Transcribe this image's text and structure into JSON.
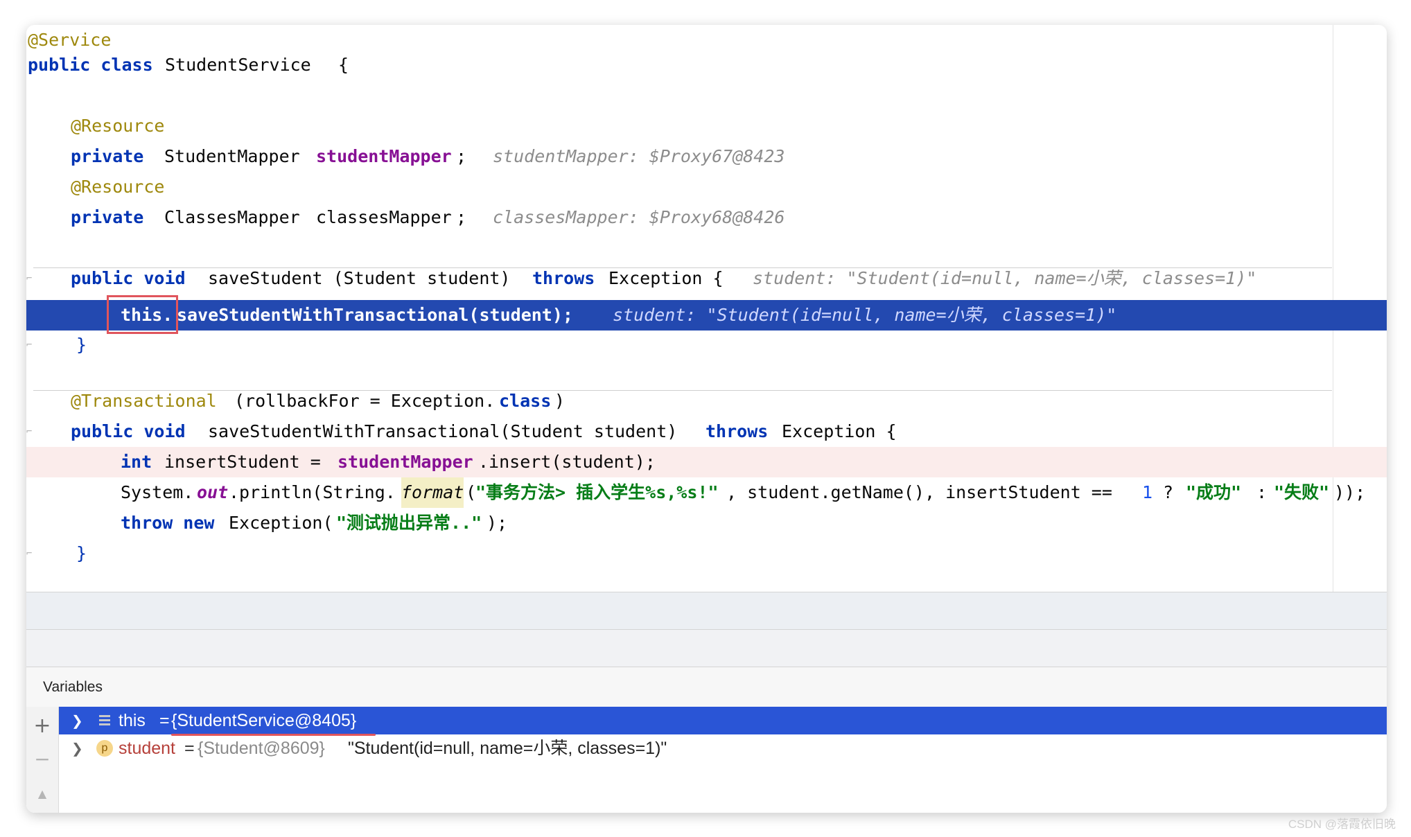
{
  "code": {
    "l1": "@Service",
    "l2_kw": "public class",
    "l2_name": "StudentService",
    "l2_brace": "{",
    "l4": "@Resource",
    "l5_kw": "private",
    "l5_type": "StudentMapper",
    "l5_field": "studentMapper",
    "l5_semi": ";",
    "l5_hint": "studentMapper: $Proxy67@8423",
    "l6": "@Resource",
    "l7_kw": "private",
    "l7_type": "ClassesMapper",
    "l7_field": "classesMapper",
    "l7_semi": ";",
    "l7_hint": "classesMapper: $Proxy68@8426",
    "l8_kw": "public void",
    "l8_sig": "saveStudent (Student student)",
    "l8_throws": "throws",
    "l8_rest": "Exception {",
    "l8_hint": "student: \"Student(id=null, name=小荣, classes=1)\"",
    "l9_this": "this.",
    "l9_call": "saveStudentWithTransactional(student);",
    "l9_hint": "student: \"Student(id=null, name=小荣, classes=1)\"",
    "l10": "}",
    "l11_ann": "@Transactional",
    "l11_open": "(rollbackFor = Exception.",
    "l11_kw": "class",
    "l11_close": ")",
    "l12_kw": "public void",
    "l12_sig": "saveStudentWithTransactional(Student student)",
    "l12_throws": "throws",
    "l12_rest": "Exception {",
    "l13_kw": "int",
    "l13_a": "insertStudent = ",
    "l13_field": "studentMapper",
    "l13_b": ".insert(student);",
    "l14_a": "System.",
    "l14_out": "out",
    "l14_b": ".println(String.",
    "l14_fmt": "format",
    "l14_c": "(",
    "l14_str1": "\"事务方法> 插入学生%s,%s!\"",
    "l14_d": ", student.getName(), insertStudent == ",
    "l14_num": "1",
    "l14_e": " ? ",
    "l14_str2": "\"成功\"",
    "l14_f": " : ",
    "l14_str3": "\"失败\"",
    "l14_g": "));",
    "l15_kw": "throw new",
    "l15_a": "Exception(",
    "l15_str": "\"测试抛出异常..\"",
    "l15_b": ");",
    "l16": "}"
  },
  "debugger": {
    "panel_title": "Variables",
    "add_label": "+",
    "remove_label": "−",
    "up_label": "▲",
    "vars": [
      {
        "name": "this",
        "eq": " = ",
        "value": "{StudentService@8405}",
        "icon": "fields-icon",
        "extra": ""
      },
      {
        "name": "student",
        "eq": " = ",
        "value": "{Student@8609}",
        "icon": "p",
        "extra": " \"Student(id=null, name=小荣, classes=1)\""
      }
    ]
  },
  "watermark": "CSDN @落霞依旧晚",
  "colors": {
    "keyword": "#0033b3",
    "annotation": "#9e880d",
    "field": "#871094",
    "string": "#067d17",
    "execution_line": "#2349b0",
    "selection": "#2a55d6",
    "breakpoint_line": "#fbeceb",
    "highlight_box": "#e0555c"
  }
}
